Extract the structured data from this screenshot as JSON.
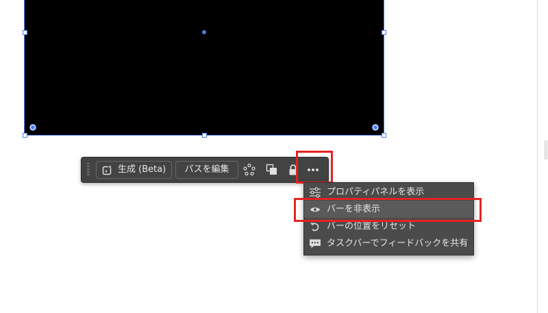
{
  "canvas": {
    "shape_fill": "#000000",
    "selection_color": "#4a7de8"
  },
  "taskbar": {
    "generate_label": "生成 (Beta)",
    "edit_path_label": "パスを編集",
    "icons": [
      "generate-sparkle-icon",
      "anchor-points-icon",
      "arrange-icon",
      "lock-icon",
      "more-options-icon"
    ]
  },
  "menu": {
    "items": [
      {
        "label": "プロパティパネルを表示",
        "icon": "properties-panel-icon"
      },
      {
        "label": "バーを非表示",
        "icon": "eye-icon"
      },
      {
        "label": "バーの位置をリセット",
        "icon": "reset-position-icon"
      },
      {
        "label": "タスクバーでフィードバックを共有",
        "icon": "feedback-icon"
      }
    ]
  },
  "annotations": {
    "highlight_color": "#e52222"
  }
}
